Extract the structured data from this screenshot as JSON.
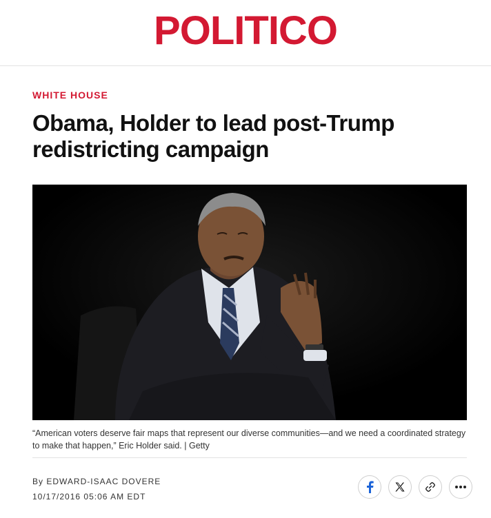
{
  "header": {
    "logo_text": "POLITICO",
    "brand_color": "#d31932"
  },
  "article": {
    "section": "WHITE HOUSE",
    "headline": "Obama, Holder to lead post-Trump redistricting campaign",
    "image_caption": "“American voters deserve fair maps that represent our diverse communities—and we need a coordinated strategy to make that happen,” Eric Holder said. | Getty",
    "byline_prefix": "By",
    "author": "EDWARD-ISAAC DOVERE",
    "timestamp": "10/17/2016 05:06 AM EDT"
  },
  "share": {
    "buttons": [
      {
        "icon": "facebook-icon"
      },
      {
        "icon": "x-icon"
      },
      {
        "icon": "link-icon"
      },
      {
        "icon": "more-icon"
      }
    ]
  }
}
